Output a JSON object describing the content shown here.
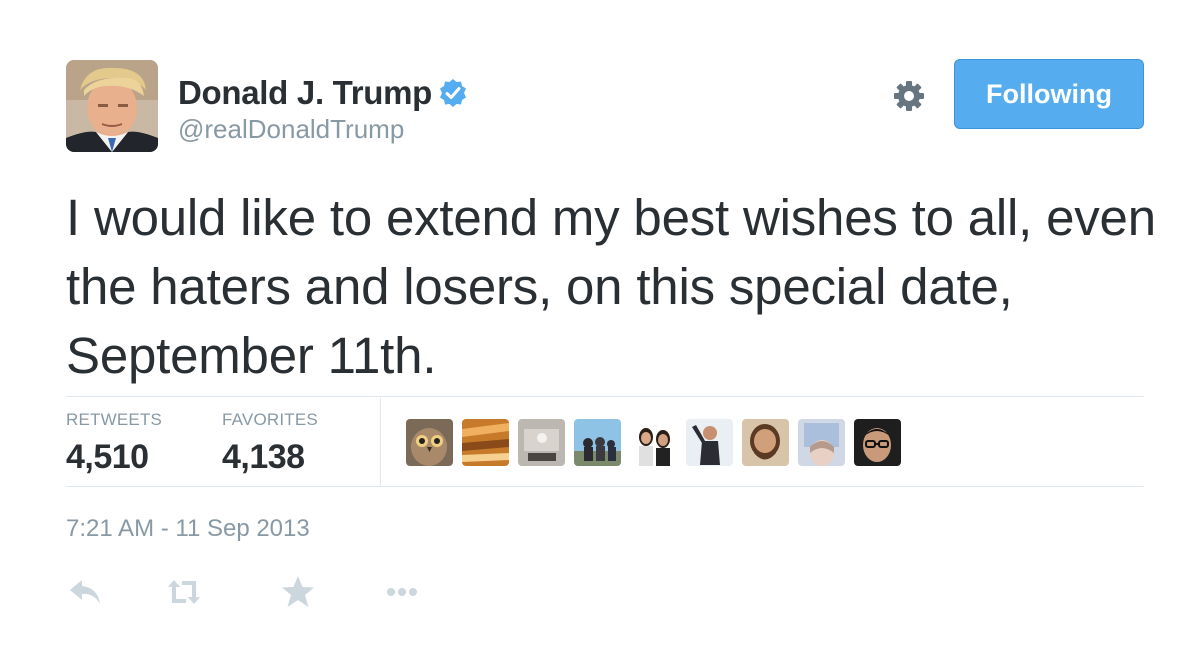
{
  "user": {
    "name": "Donald J. Trump",
    "handle": "@realDonaldTrump",
    "verified": true,
    "avatar_icon": "profile-photo"
  },
  "follow_button": {
    "label": "Following"
  },
  "settings_icon": "gear-icon",
  "tweet": {
    "text": "I would like to extend my best wishes to all, even the haters and losers, on this special date, September 11th."
  },
  "stats": {
    "retweets_label": "RETWEETS",
    "retweets_count": "4,510",
    "favorites_label": "FAVORITES",
    "favorites_count": "4,138"
  },
  "favoriter_avatars": [
    "owl",
    "abstract-orange",
    "room",
    "group-photo",
    "two-women",
    "man-with-arm-up",
    "bearded-man",
    "girl-in-window",
    "man-with-glasses"
  ],
  "timestamp": "7:21 AM - 11 Sep 2013",
  "actions": [
    "reply-icon",
    "retweet-icon",
    "favorite-star-icon",
    "more-dots-icon"
  ],
  "colors": {
    "accent": "#55acee",
    "text": "#292f33",
    "muted": "#8899a6",
    "divider": "#e1e8ed",
    "action_icon": "#ccd6dd"
  }
}
